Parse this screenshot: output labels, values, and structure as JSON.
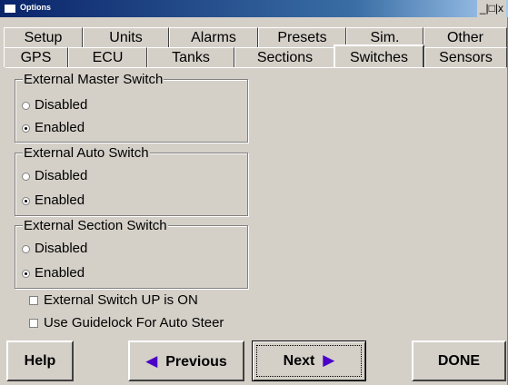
{
  "window": {
    "title": "Options",
    "controls": "_|□|x"
  },
  "tabs_row1": [
    {
      "label": "Setup"
    },
    {
      "label": "Units"
    },
    {
      "label": "Alarms"
    },
    {
      "label": "Presets"
    },
    {
      "label": "Sim."
    },
    {
      "label": "Other"
    }
  ],
  "tabs_row2": [
    {
      "label": "GPS"
    },
    {
      "label": "ECU"
    },
    {
      "label": "Tanks"
    },
    {
      "label": "Sections"
    },
    {
      "label": "Switches",
      "active": true
    },
    {
      "label": "Sensors"
    }
  ],
  "groups": [
    {
      "title": "External Master Switch",
      "options": [
        {
          "label": "Disabled",
          "checked": false
        },
        {
          "label": "Enabled",
          "checked": true
        }
      ]
    },
    {
      "title": "External Auto Switch",
      "options": [
        {
          "label": "Disabled",
          "checked": false
        },
        {
          "label": "Enabled",
          "checked": true
        }
      ]
    },
    {
      "title": "External Section Switch",
      "options": [
        {
          "label": "Disabled",
          "checked": false
        },
        {
          "label": "Enabled",
          "checked": true
        }
      ]
    }
  ],
  "checkboxes": [
    {
      "label": "External Switch UP is ON",
      "checked": false
    },
    {
      "label": "Use Guidelock For Auto Steer",
      "checked": false
    }
  ],
  "buttons": {
    "help": "Help",
    "previous": "Previous",
    "previous_arrow": "◀",
    "next": "Next",
    "next_arrow": "▶",
    "done": "DONE"
  },
  "colors": {
    "title_bar": "#0a246a",
    "face": "#d4d0c8",
    "arrow": "#4b00c8"
  }
}
